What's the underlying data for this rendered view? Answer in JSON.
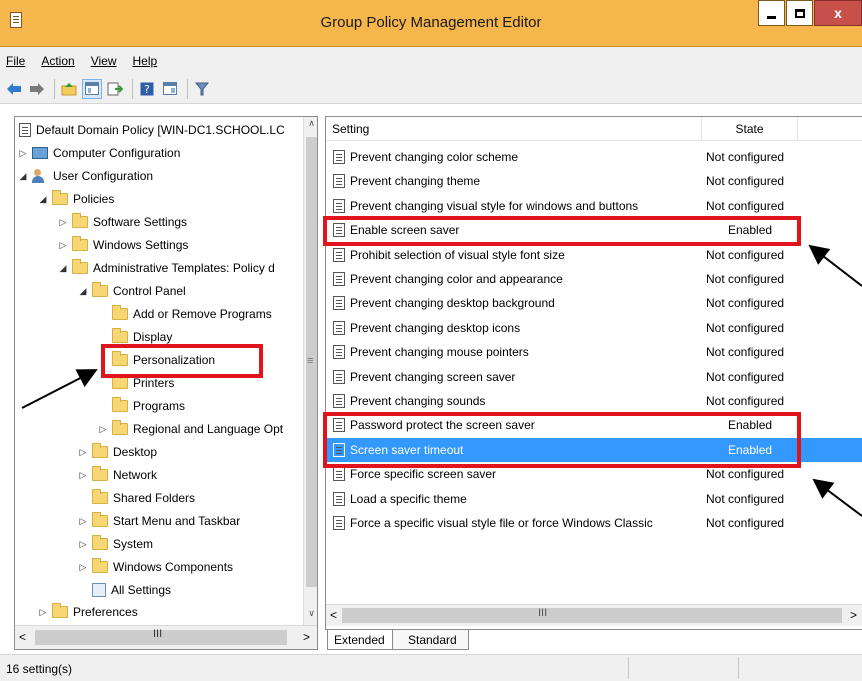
{
  "window": {
    "title": "Group Policy Management Editor"
  },
  "menu": {
    "items": [
      "File",
      "Action",
      "View",
      "Help"
    ]
  },
  "toolbar": {
    "icons": [
      "back-arrow-icon",
      "forward-arrow-icon",
      "up-folder-icon",
      "show-hide-tree-icon",
      "export-list-icon",
      "help-icon",
      "properties-icon",
      "filter-icon"
    ]
  },
  "tree": {
    "root": "Default Domain Policy [WIN-DC1.SCHOOL.LC",
    "computer_config": "Computer Configuration",
    "user_config": "User Configuration",
    "policies": "Policies",
    "software_settings": "Software Settings",
    "windows_settings": "Windows Settings",
    "admin_templates": "Administrative Templates: Policy d",
    "control_panel": "Control Panel",
    "add_remove": "Add or Remove Programs",
    "display": "Display",
    "personalization": "Personalization",
    "printers": "Printers",
    "programs": "Programs",
    "regional": "Regional and Language Opt",
    "desktop": "Desktop",
    "network": "Network",
    "shared_folders": "Shared Folders",
    "start_menu": "Start Menu and Taskbar",
    "system": "System",
    "windows_components": "Windows Components",
    "all_settings": "All Settings",
    "preferences": "Preferences"
  },
  "list": {
    "headers": {
      "setting": "Setting",
      "state": "State"
    },
    "rows": [
      {
        "name": "Prevent changing color scheme",
        "state": "Not configured"
      },
      {
        "name": "Prevent changing theme",
        "state": "Not configured"
      },
      {
        "name": "Prevent changing visual style for windows and buttons",
        "state": "Not configured"
      },
      {
        "name": "Enable screen saver",
        "state": "Enabled"
      },
      {
        "name": "Prohibit selection of visual style font size",
        "state": "Not configured"
      },
      {
        "name": "Prevent changing color and appearance",
        "state": "Not configured"
      },
      {
        "name": "Prevent changing desktop background",
        "state": "Not configured"
      },
      {
        "name": "Prevent changing desktop icons",
        "state": "Not configured"
      },
      {
        "name": "Prevent changing mouse pointers",
        "state": "Not configured"
      },
      {
        "name": "Prevent changing screen saver",
        "state": "Not configured"
      },
      {
        "name": "Prevent changing sounds",
        "state": "Not configured"
      },
      {
        "name": "Password protect the screen saver",
        "state": "Enabled"
      },
      {
        "name": "Screen saver timeout",
        "state": "Enabled"
      },
      {
        "name": "Force specific screen saver",
        "state": "Not configured"
      },
      {
        "name": "Load a specific theme",
        "state": "Not configured"
      },
      {
        "name": "Force a specific visual style file or force Windows Classic",
        "state": "Not configured"
      }
    ]
  },
  "tabs": {
    "extended": "Extended",
    "standard": "Standard"
  },
  "status": {
    "text": "16 setting(s)"
  },
  "colors": {
    "titlebar": "#f5b64c",
    "selection": "#3399ff",
    "annotation": "#e0141c"
  }
}
